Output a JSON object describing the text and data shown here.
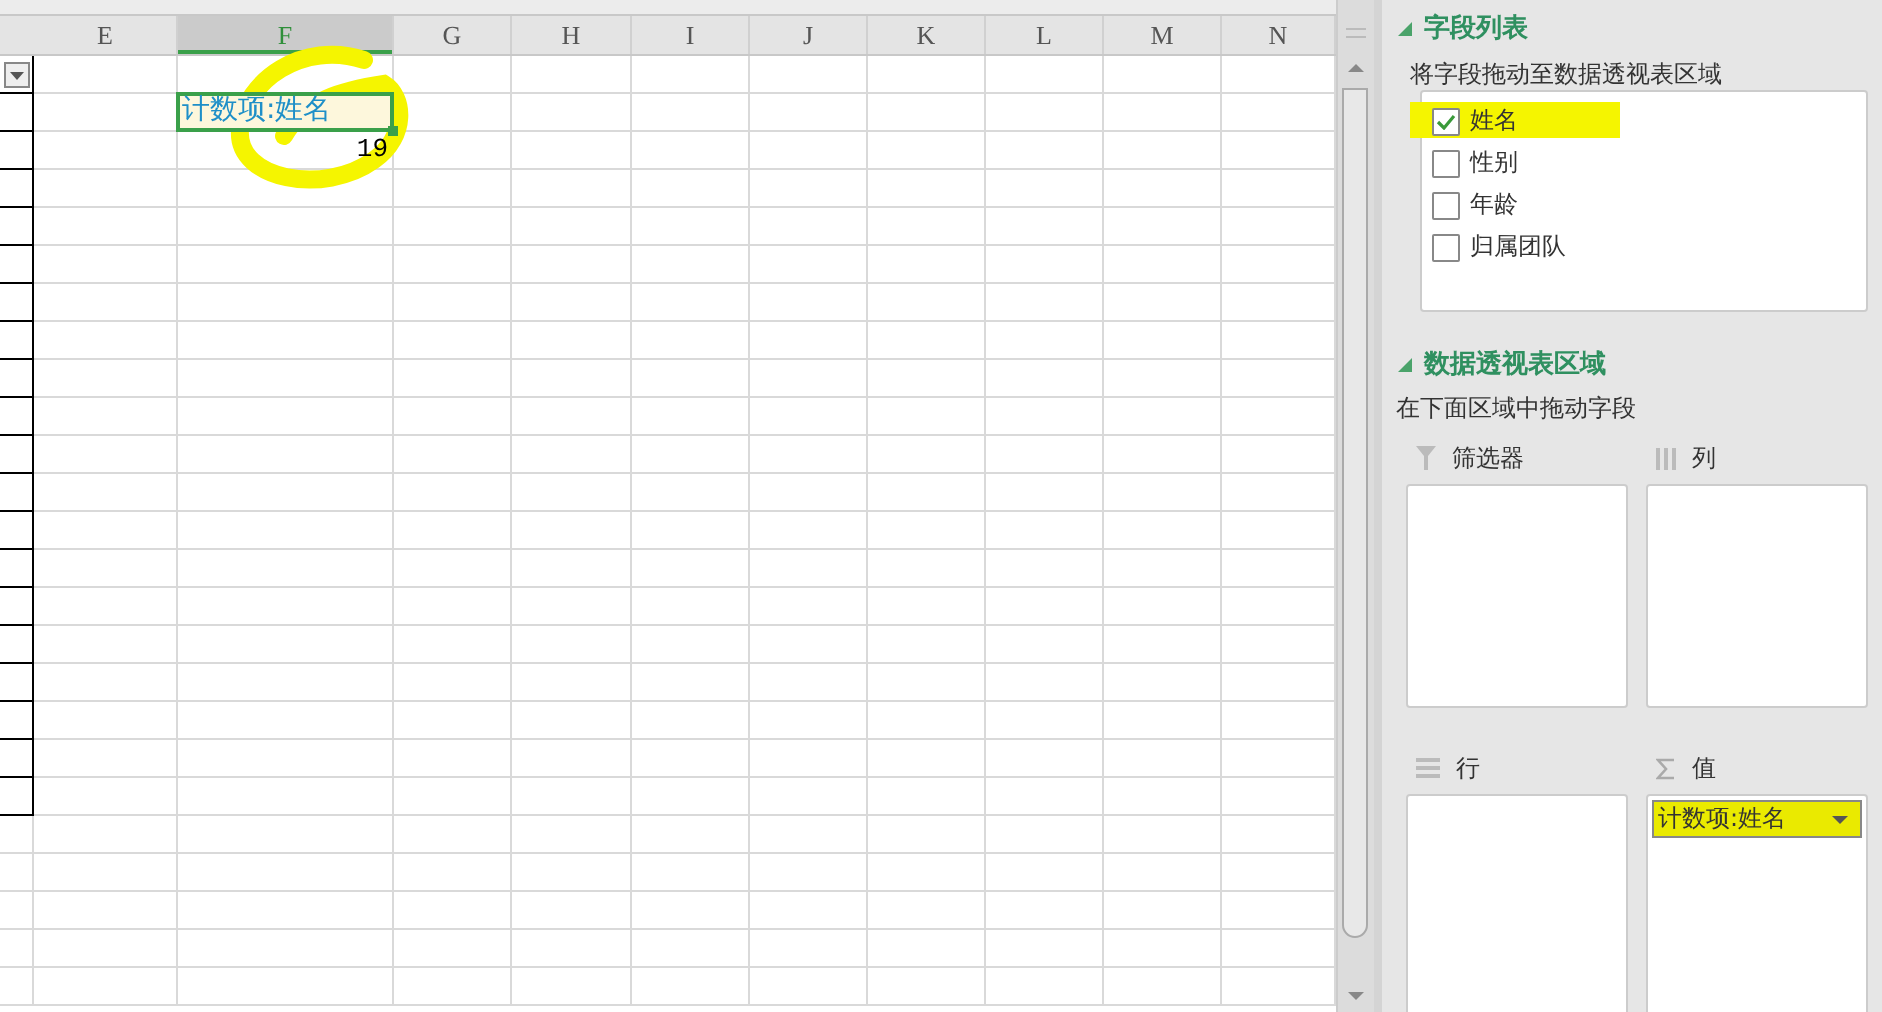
{
  "sheet": {
    "columns": [
      {
        "label": "E",
        "selected": false
      },
      {
        "label": "F",
        "selected": true
      },
      {
        "label": "G",
        "selected": false
      },
      {
        "label": "H",
        "selected": false
      },
      {
        "label": "I",
        "selected": false
      },
      {
        "label": "J",
        "selected": false
      },
      {
        "label": "K",
        "selected": false
      },
      {
        "label": "L",
        "selected": false
      },
      {
        "label": "M",
        "selected": false
      },
      {
        "label": "N",
        "selected": false
      }
    ],
    "pivot_header": "计数项:姓名",
    "pivot_value": "19"
  },
  "panel": {
    "field_list": {
      "title": "字段列表",
      "hint": "将字段拖动至数据透视表区域",
      "fields": [
        {
          "label": "姓名",
          "checked": true
        },
        {
          "label": "性别",
          "checked": false
        },
        {
          "label": "年龄",
          "checked": false
        },
        {
          "label": "归属团队",
          "checked": false
        }
      ]
    },
    "areas": {
      "title": "数据透视表区域",
      "hint": "在下面区域中拖动字段",
      "boxes": [
        {
          "kind": "filter",
          "label": "筛选器"
        },
        {
          "kind": "columns",
          "label": "列"
        },
        {
          "kind": "rows",
          "label": "行"
        },
        {
          "kind": "values",
          "label": "值",
          "items": [
            "计数项:姓名"
          ]
        }
      ]
    }
  }
}
